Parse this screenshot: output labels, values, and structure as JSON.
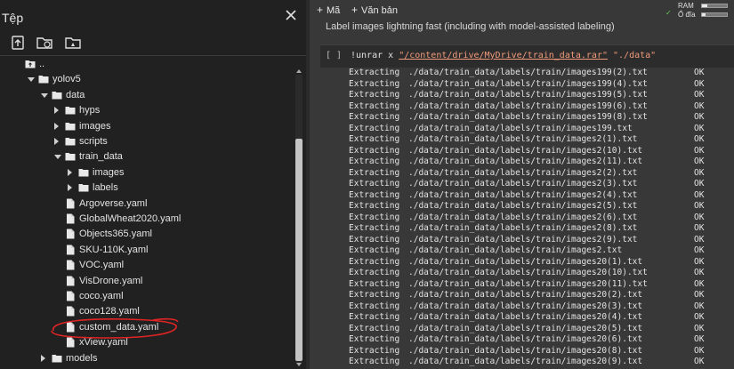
{
  "sidebar": {
    "title": "Tệp",
    "tree": [
      {
        "label": "..",
        "indent": 0,
        "type": "parent",
        "arrow": "none"
      },
      {
        "label": "yolov5",
        "indent": 1,
        "type": "folder",
        "arrow": "down"
      },
      {
        "label": "data",
        "indent": 2,
        "type": "folder",
        "arrow": "down"
      },
      {
        "label": "hyps",
        "indent": 3,
        "type": "folder",
        "arrow": "right"
      },
      {
        "label": "images",
        "indent": 3,
        "type": "folder",
        "arrow": "right"
      },
      {
        "label": "scripts",
        "indent": 3,
        "type": "folder",
        "arrow": "right"
      },
      {
        "label": "train_data",
        "indent": 3,
        "type": "folder",
        "arrow": "down"
      },
      {
        "label": "images",
        "indent": 4,
        "type": "folder",
        "arrow": "right"
      },
      {
        "label": "labels",
        "indent": 4,
        "type": "folder",
        "arrow": "right"
      },
      {
        "label": "Argoverse.yaml",
        "indent": 3,
        "type": "file",
        "arrow": "none"
      },
      {
        "label": "GlobalWheat2020.yaml",
        "indent": 3,
        "type": "file",
        "arrow": "none"
      },
      {
        "label": "Objects365.yaml",
        "indent": 3,
        "type": "file",
        "arrow": "none"
      },
      {
        "label": "SKU-110K.yaml",
        "indent": 3,
        "type": "file",
        "arrow": "none"
      },
      {
        "label": "VOC.yaml",
        "indent": 3,
        "type": "file",
        "arrow": "none"
      },
      {
        "label": "VisDrone.yaml",
        "indent": 3,
        "type": "file",
        "arrow": "none"
      },
      {
        "label": "coco.yaml",
        "indent": 3,
        "type": "file",
        "arrow": "none"
      },
      {
        "label": "coco128.yaml",
        "indent": 3,
        "type": "file",
        "arrow": "none"
      },
      {
        "label": "custom_data.yaml",
        "indent": 3,
        "type": "file",
        "arrow": "none"
      },
      {
        "label": "xView.yaml",
        "indent": 3,
        "type": "file",
        "arrow": "none"
      },
      {
        "label": "models",
        "indent": 2,
        "type": "folder",
        "arrow": "right"
      }
    ]
  },
  "toolbar": {
    "code_label": "Mã",
    "text_label": "Văn bản",
    "ram_label": "RAM",
    "disk_label": "Ổ đĩa",
    "ram_fill": 0.2,
    "disk_fill": 0.15
  },
  "notebook": {
    "markdown_text": "Label images lightning fast (including with model-assisted labeling)",
    "cell": {
      "run_indicator": "[ ]",
      "code_prefix": "!unrar x ",
      "code_path": "\"/content/drive/MyDrive/train_data.rar\"",
      "code_suffix": " \"./data\""
    },
    "output": [
      {
        "verb": "Extracting",
        "path": "./data/train_data/labels/train/images199(2).txt",
        "status": "OK"
      },
      {
        "verb": "Extracting",
        "path": "./data/train_data/labels/train/images199(4).txt",
        "status": "OK"
      },
      {
        "verb": "Extracting",
        "path": "./data/train_data/labels/train/images199(5).txt",
        "status": "OK"
      },
      {
        "verb": "Extracting",
        "path": "./data/train_data/labels/train/images199(6).txt",
        "status": "OK"
      },
      {
        "verb": "Extracting",
        "path": "./data/train_data/labels/train/images199(8).txt",
        "status": "OK"
      },
      {
        "verb": "Extracting",
        "path": "./data/train_data/labels/train/images199.txt",
        "status": "OK"
      },
      {
        "verb": "Extracting",
        "path": "./data/train_data/labels/train/images2(1).txt",
        "status": "OK"
      },
      {
        "verb": "Extracting",
        "path": "./data/train_data/labels/train/images2(10).txt",
        "status": "OK"
      },
      {
        "verb": "Extracting",
        "path": "./data/train_data/labels/train/images2(11).txt",
        "status": "OK"
      },
      {
        "verb": "Extracting",
        "path": "./data/train_data/labels/train/images2(2).txt",
        "status": "OK"
      },
      {
        "verb": "Extracting",
        "path": "./data/train_data/labels/train/images2(3).txt",
        "status": "OK"
      },
      {
        "verb": "Extracting",
        "path": "./data/train_data/labels/train/images2(4).txt",
        "status": "OK"
      },
      {
        "verb": "Extracting",
        "path": "./data/train_data/labels/train/images2(5).txt",
        "status": "OK"
      },
      {
        "verb": "Extracting",
        "path": "./data/train_data/labels/train/images2(6).txt",
        "status": "OK"
      },
      {
        "verb": "Extracting",
        "path": "./data/train_data/labels/train/images2(8).txt",
        "status": "OK"
      },
      {
        "verb": "Extracting",
        "path": "./data/train_data/labels/train/images2(9).txt",
        "status": "OK"
      },
      {
        "verb": "Extracting",
        "path": "./data/train_data/labels/train/images2.txt",
        "status": "OK"
      },
      {
        "verb": "Extracting",
        "path": "./data/train_data/labels/train/images20(1).txt",
        "status": "OK"
      },
      {
        "verb": "Extracting",
        "path": "./data/train_data/labels/train/images20(10).txt",
        "status": "OK"
      },
      {
        "verb": "Extracting",
        "path": "./data/train_data/labels/train/images20(11).txt",
        "status": "OK"
      },
      {
        "verb": "Extracting",
        "path": "./data/train_data/labels/train/images20(2).txt",
        "status": "OK"
      },
      {
        "verb": "Extracting",
        "path": "./data/train_data/labels/train/images20(3).txt",
        "status": "OK"
      },
      {
        "verb": "Extracting",
        "path": "./data/train_data/labels/train/images20(4).txt",
        "status": "OK"
      },
      {
        "verb": "Extracting",
        "path": "./data/train_data/labels/train/images20(5).txt",
        "status": "OK"
      },
      {
        "verb": "Extracting",
        "path": "./data/train_data/labels/train/images20(6).txt",
        "status": "OK"
      },
      {
        "verb": "Extracting",
        "path": "./data/train_data/labels/train/images20(8).txt",
        "status": "OK"
      },
      {
        "verb": "Extracting",
        "path": "./data/train_data/labels/train/images20(9).txt",
        "status": "OK"
      }
    ]
  },
  "colors": {
    "annotation_red": "#e02424",
    "string_orange": "#f29b7c",
    "status_green": "#5fd35f"
  }
}
